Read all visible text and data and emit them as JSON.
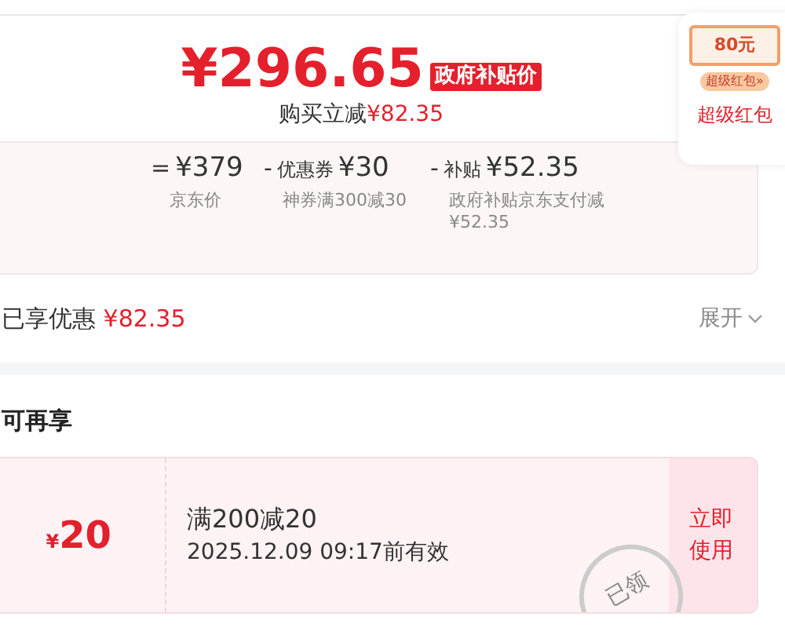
{
  "price": {
    "amount": "¥296.65",
    "badge": "政府补贴价",
    "saving_label": "购买立减",
    "saving_value": "¥82.35"
  },
  "red_packet": {
    "amount": "80元",
    "tag": "超级红包»",
    "label": "超级红包"
  },
  "breakdown": [
    {
      "op": "=",
      "value": "¥379",
      "note": "京东价"
    },
    {
      "op": "-",
      "name": "优惠券",
      "value": "¥30",
      "note": "神券满300减30"
    },
    {
      "op": "-",
      "name": "补贴",
      "value": "¥52.35",
      "note": "政府补贴京东支付减¥52.35"
    }
  ],
  "enjoyed": {
    "label": "已享优惠",
    "value": "¥82.35",
    "expand": "展开"
  },
  "section_title": "可再享",
  "coupons": [
    {
      "currency": "¥",
      "amount": "20",
      "title": "满200减20",
      "validity": "2025.12.09 09:17前有效",
      "action": "立即使用",
      "stamp": "已领",
      "claimed": true
    }
  ]
}
